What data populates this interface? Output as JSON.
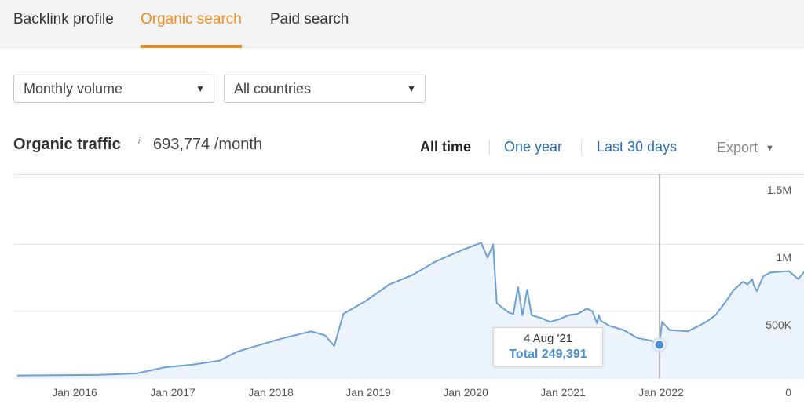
{
  "tabs": [
    {
      "label": "Backlink profile",
      "active": false
    },
    {
      "label": "Organic search",
      "active": true
    },
    {
      "label": "Paid search",
      "active": false
    }
  ],
  "filters": {
    "volume": "Monthly volume",
    "country": "All countries"
  },
  "header": {
    "title": "Organic traffic",
    "info_mark": "i",
    "value": "693,774 /month"
  },
  "ranges": {
    "all_time": "All time",
    "one_year": "One year",
    "last_30_days": "Last 30 days",
    "active": "All time"
  },
  "export_label": "Export",
  "tooltip": {
    "date": "4 Aug '21",
    "total": "Total 249,391"
  },
  "colors": {
    "accent": "#f28b21",
    "line": "#6a9fd8",
    "area": "#edf3fb",
    "link": "#2a6ebb"
  },
  "icons": {
    "caret": "caret-down-icon",
    "info": "info-icon"
  },
  "chart_data": {
    "type": "area",
    "x_ticks": [
      "Jan 2016",
      "Jan 2017",
      "Jan 2018",
      "Jan 2019",
      "Jan 2020",
      "Jan 2021",
      "Jan 2022"
    ],
    "y_ticks": [
      "0",
      "500K",
      "1M",
      "1.5M"
    ],
    "ylim": [
      0,
      1500000
    ],
    "xlim": [
      2015.6,
      2023.6
    ],
    "grid": true,
    "points": [
      [
        2015.6,
        20000
      ],
      [
        2016.0,
        22000
      ],
      [
        2016.5,
        25000
      ],
      [
        2016.9,
        35000
      ],
      [
        2017.2,
        80000
      ],
      [
        2017.5,
        100000
      ],
      [
        2017.8,
        130000
      ],
      [
        2018.0,
        200000
      ],
      [
        2018.3,
        260000
      ],
      [
        2018.5,
        300000
      ],
      [
        2018.8,
        350000
      ],
      [
        2018.95,
        320000
      ],
      [
        2019.05,
        240000
      ],
      [
        2019.15,
        480000
      ],
      [
        2019.4,
        580000
      ],
      [
        2019.65,
        700000
      ],
      [
        2019.9,
        770000
      ],
      [
        2020.15,
        870000
      ],
      [
        2020.45,
        960000
      ],
      [
        2020.65,
        1010000
      ],
      [
        2020.72,
        900000
      ],
      [
        2020.78,
        1000000
      ],
      [
        2020.82,
        560000
      ],
      [
        2020.95,
        490000
      ],
      [
        2021.0,
        480000
      ],
      [
        2021.05,
        680000
      ],
      [
        2021.1,
        470000
      ],
      [
        2021.15,
        660000
      ],
      [
        2021.2,
        470000
      ],
      [
        2021.3,
        450000
      ],
      [
        2021.4,
        420000
      ],
      [
        2021.45,
        430000
      ],
      [
        2021.5,
        440000
      ],
      [
        2021.6,
        470000
      ],
      [
        2021.7,
        480000
      ],
      [
        2021.8,
        520000
      ],
      [
        2021.86,
        500000
      ],
      [
        2021.91,
        410000
      ],
      [
        2021.93,
        470000
      ],
      [
        2021.95,
        430000
      ],
      [
        2021.97,
        420000
      ],
      [
        2022.05,
        390000
      ],
      [
        2022.2,
        360000
      ],
      [
        2022.35,
        300000
      ],
      [
        2022.5,
        280000
      ],
      [
        2022.59,
        249391
      ],
      [
        2022.62,
        420000
      ],
      [
        2022.7,
        360000
      ],
      [
        2022.9,
        350000
      ],
      [
        2023.1,
        420000
      ],
      [
        2023.2,
        470000
      ],
      [
        2023.3,
        560000
      ],
      [
        2023.4,
        660000
      ],
      [
        2023.5,
        720000
      ],
      [
        2023.55,
        700000
      ],
      [
        2023.6,
        740000
      ],
      [
        2023.62,
        690000
      ],
      [
        2023.65,
        650000
      ],
      [
        2023.72,
        760000
      ],
      [
        2023.8,
        790000
      ],
      [
        2024.0,
        800000
      ],
      [
        2024.1,
        740000
      ],
      [
        2024.2,
        820000
      ],
      [
        2024.3,
        770000
      ]
    ],
    "highlight": {
      "x": 2022.59,
      "y": 249391
    }
  }
}
